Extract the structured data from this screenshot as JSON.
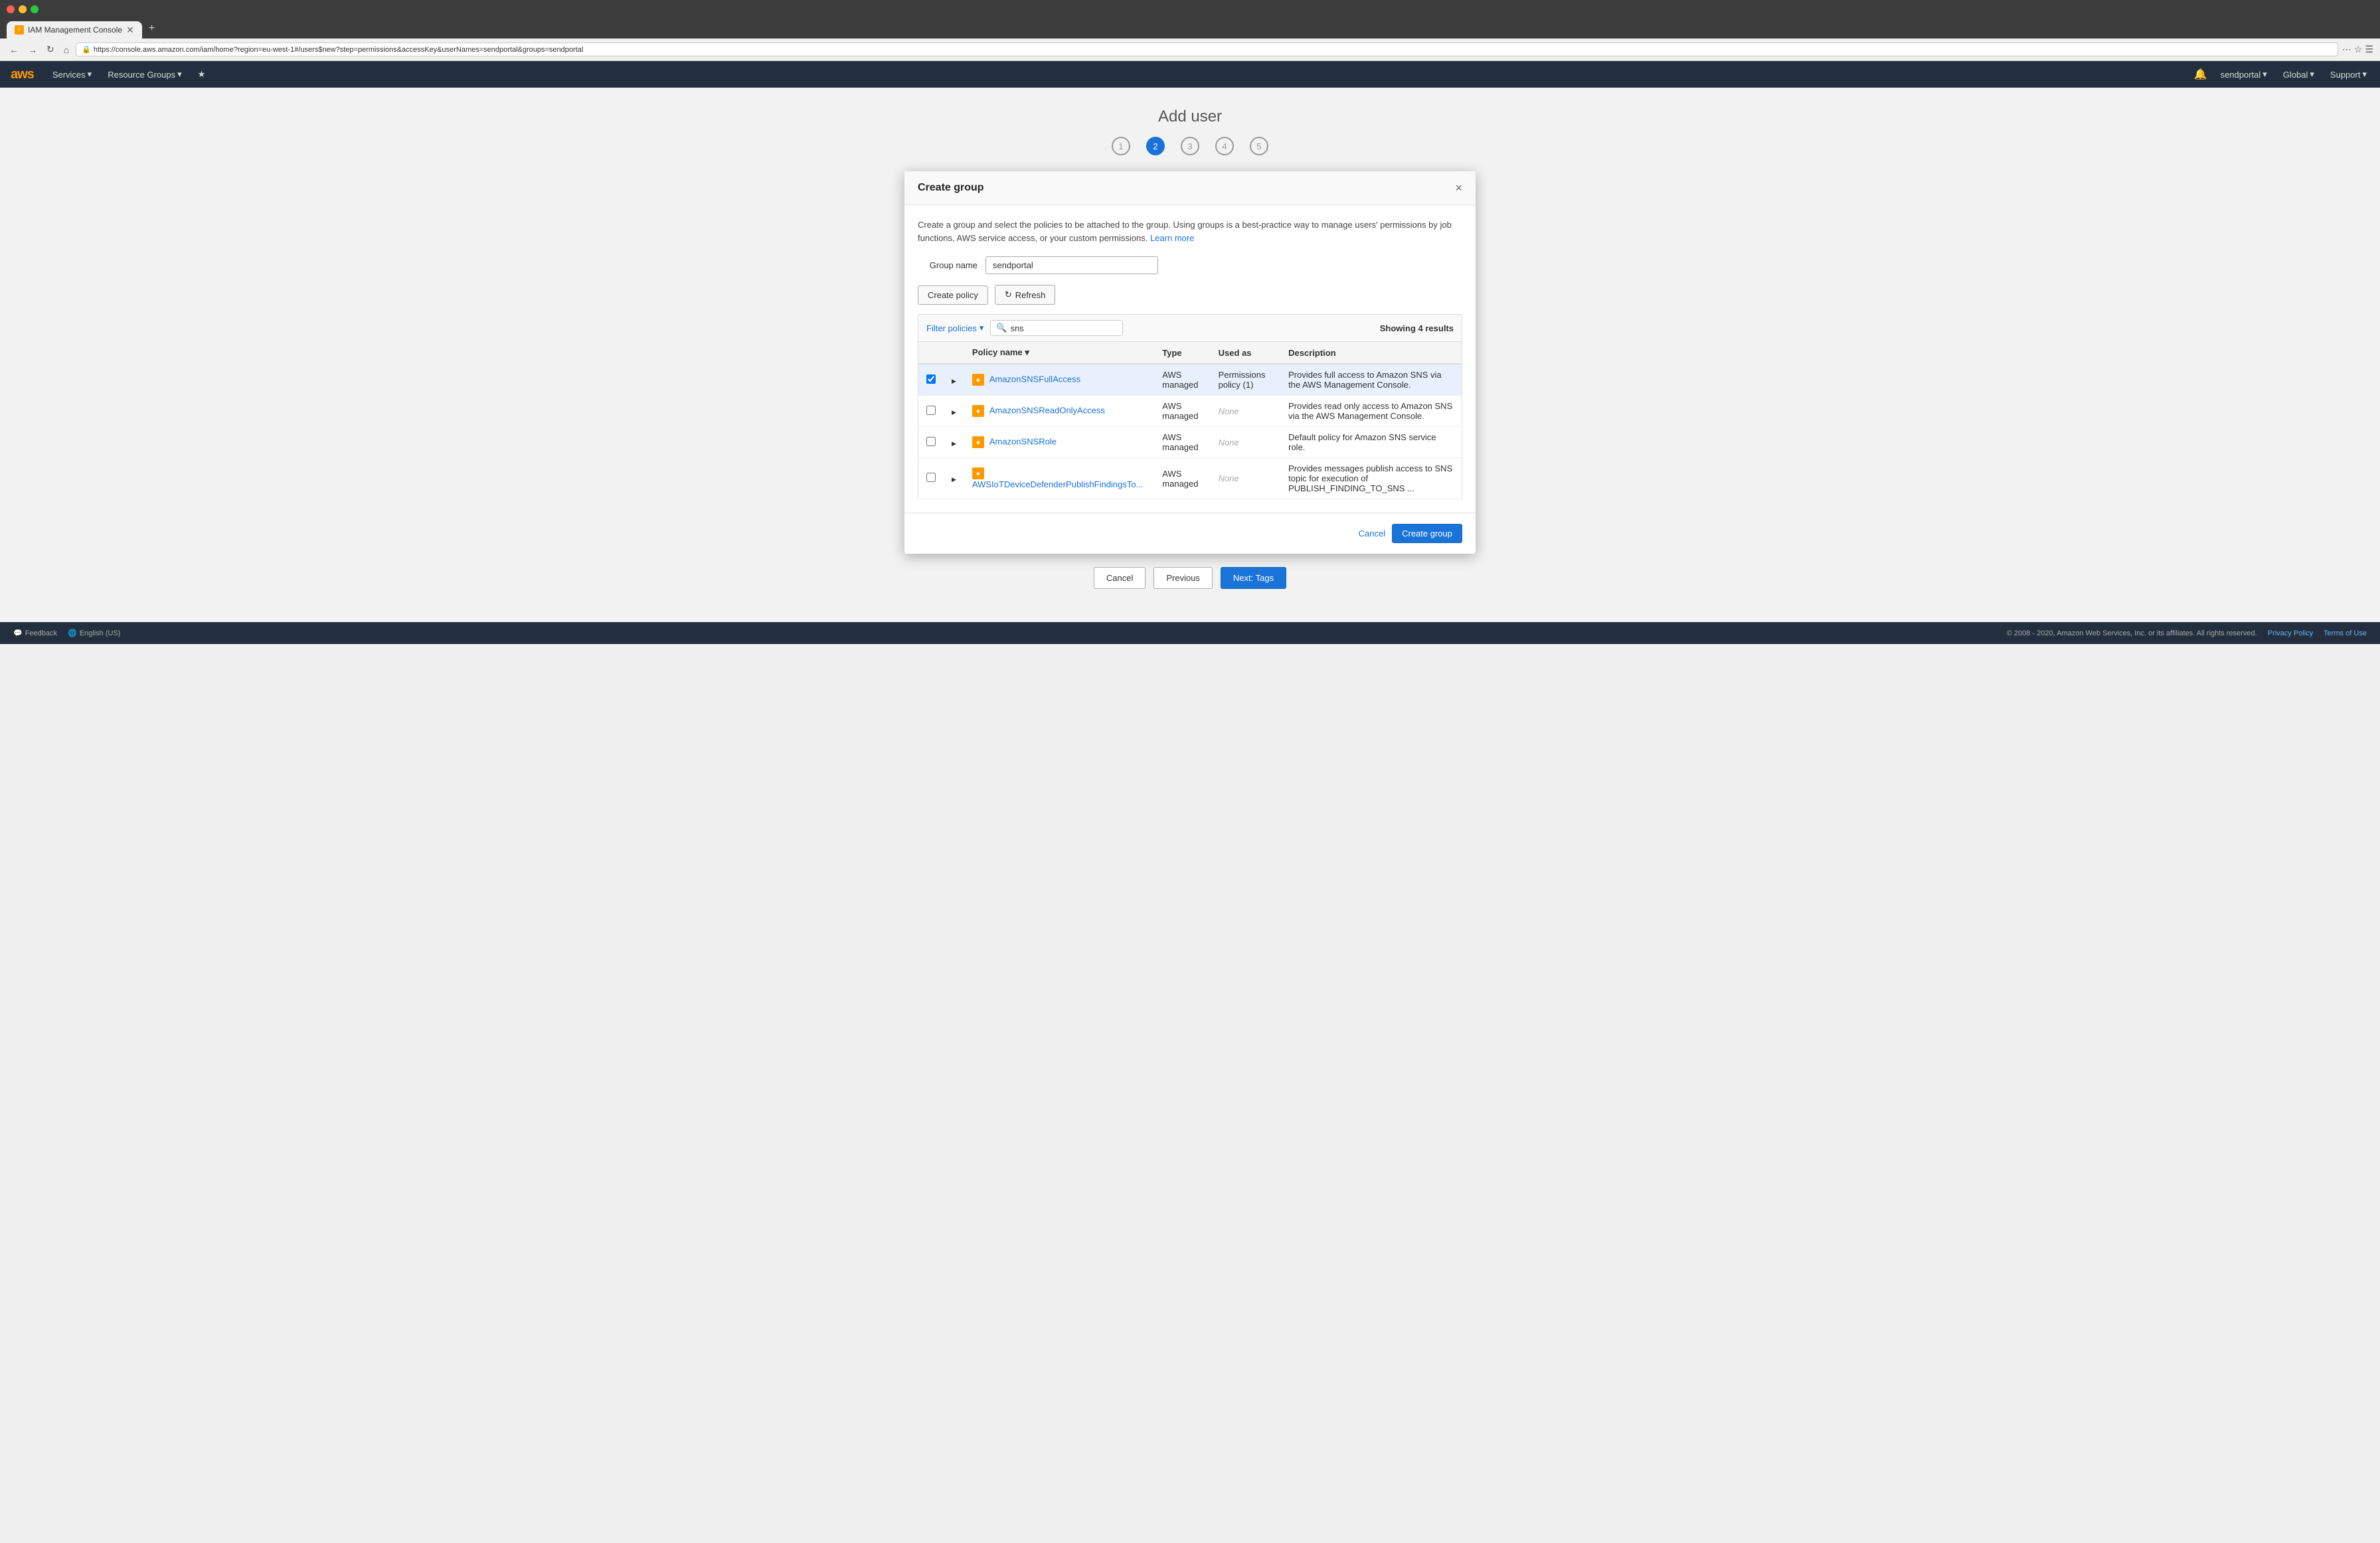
{
  "browser": {
    "tab_title": "IAM Management Console",
    "url": "https://console.aws.amazon.com/iam/home?region=eu-west-1#/users$new?step=permissions&accessKey&userNames=sendportal&groups=sendportal",
    "new_tab_label": "+"
  },
  "aws_nav": {
    "logo": "aws",
    "services_label": "Services",
    "resource_groups_label": "Resource Groups",
    "user_label": "sendportal",
    "region_label": "Global",
    "support_label": "Support"
  },
  "page": {
    "title": "Add user",
    "steps": [
      "1",
      "2",
      "3",
      "4",
      "5"
    ],
    "active_step": 2
  },
  "modal": {
    "title": "Create group",
    "close_label": "×",
    "description": "Create a group and select the policies to be attached to the group. Using groups is a best-practice way to manage users' permissions by job functions, AWS service access, or your custom permissions.",
    "learn_more_label": "Learn more",
    "group_name_label": "Group name",
    "group_name_value": "sendportal",
    "create_policy_label": "Create policy",
    "refresh_label": "Refresh",
    "filter_policies_label": "Filter policies",
    "search_placeholder": "sns",
    "results_count_label": "Showing 4 results",
    "table": {
      "columns": [
        "Policy name",
        "Type",
        "Used as",
        "Description"
      ],
      "rows": [
        {
          "checked": true,
          "name": "AmazonSNSFullAccess",
          "type": "AWS managed",
          "used_as": "Permissions policy (1)",
          "description": "Provides full access to Amazon SNS via the AWS Management Console.",
          "selected": true
        },
        {
          "checked": false,
          "name": "AmazonSNSReadOnlyAccess",
          "type": "AWS managed",
          "used_as": "None",
          "description": "Provides read only access to Amazon SNS via the AWS Management Console.",
          "selected": false
        },
        {
          "checked": false,
          "name": "AmazonSNSRole",
          "type": "AWS managed",
          "used_as": "None",
          "description": "Default policy for Amazon SNS service role.",
          "selected": false
        },
        {
          "checked": false,
          "name": "AWSIoTDeviceDefenderPublishFindingsTo...",
          "type": "AWS managed",
          "used_as": "None",
          "description": "Provides messages publish access to SNS topic for execution of PUBLISH_FINDING_TO_SNS ...",
          "selected": false
        }
      ]
    },
    "cancel_label": "Cancel",
    "create_group_label": "Create group"
  },
  "page_footer": {
    "cancel_label": "Cancel",
    "previous_label": "Previous",
    "next_label": "Next: Tags"
  },
  "footer": {
    "feedback_label": "Feedback",
    "language_label": "English (US)",
    "copyright": "© 2008 - 2020, Amazon Web Services, Inc. or its affiliates. All rights reserved.",
    "privacy_label": "Privacy Policy",
    "terms_label": "Terms of Use"
  }
}
